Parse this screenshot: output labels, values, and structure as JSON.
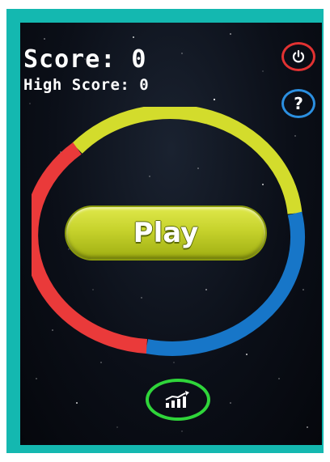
{
  "hud": {
    "score_label": "Score: 0",
    "high_score_label": "High Score: 0"
  },
  "buttons": {
    "play_label": "Play",
    "help_label": "?",
    "power_icon": "power-icon",
    "stats_icon": "stats-chart-icon"
  },
  "ring": {
    "segments": [
      {
        "color": "#d3dc2c",
        "name": "yellow"
      },
      {
        "color": "#1776c8",
        "name": "blue"
      },
      {
        "color": "#ea3a3a",
        "name": "red"
      }
    ]
  },
  "colors": {
    "frame": "#14b8b0",
    "power_border": "#e23232",
    "help_border": "#2b8fe0",
    "stats_border": "#2fd53a",
    "play_button": "#c6d22c"
  }
}
